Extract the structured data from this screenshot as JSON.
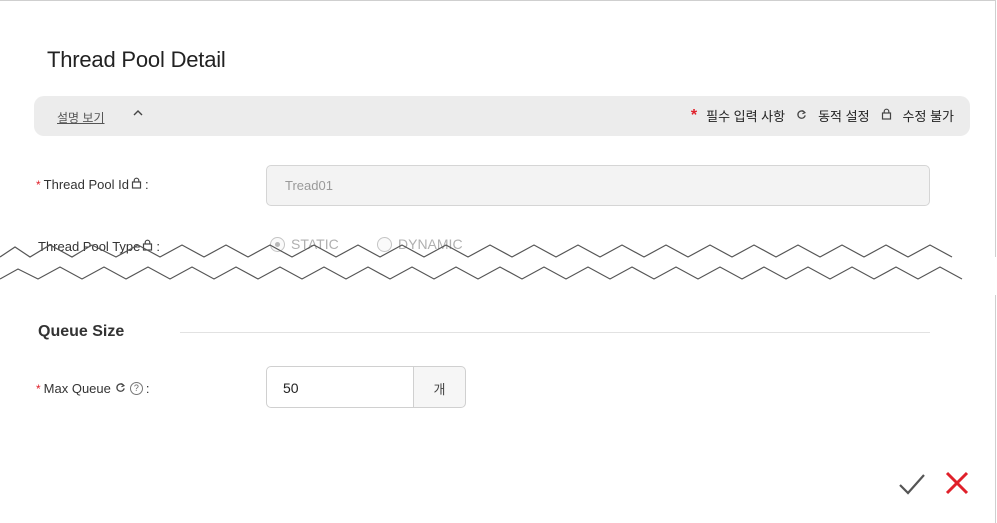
{
  "dialog": {
    "title": "Thread Pool Detail"
  },
  "infobar": {
    "description_link": "설명 보기",
    "legend": {
      "required_star": "*",
      "required_label": "필수 입력 사항",
      "dynamic_icon": "refresh-icon",
      "dynamic_label": "동적 설정",
      "lock_icon": "lock-icon",
      "readonly_label": "수정 불가"
    }
  },
  "fields": {
    "thread_pool_id": {
      "required": "*",
      "label": "Thread Pool Id",
      "suffix": ":",
      "value": "Tread01"
    },
    "thread_pool_type": {
      "label": "Thread Pool Type",
      "suffix": ":",
      "options": [
        "STATIC",
        "DYNAMIC"
      ],
      "selected": "STATIC"
    }
  },
  "queue_section": {
    "title": "Queue Size",
    "max_queue": {
      "required": "*",
      "label": "Max Queue",
      "help": "?",
      "suffix": ":",
      "value": "50",
      "unit": "개"
    }
  },
  "actions": {
    "confirm_icon": "check-icon",
    "cancel_icon": "close-icon",
    "cancel_color": "#e0202a"
  }
}
